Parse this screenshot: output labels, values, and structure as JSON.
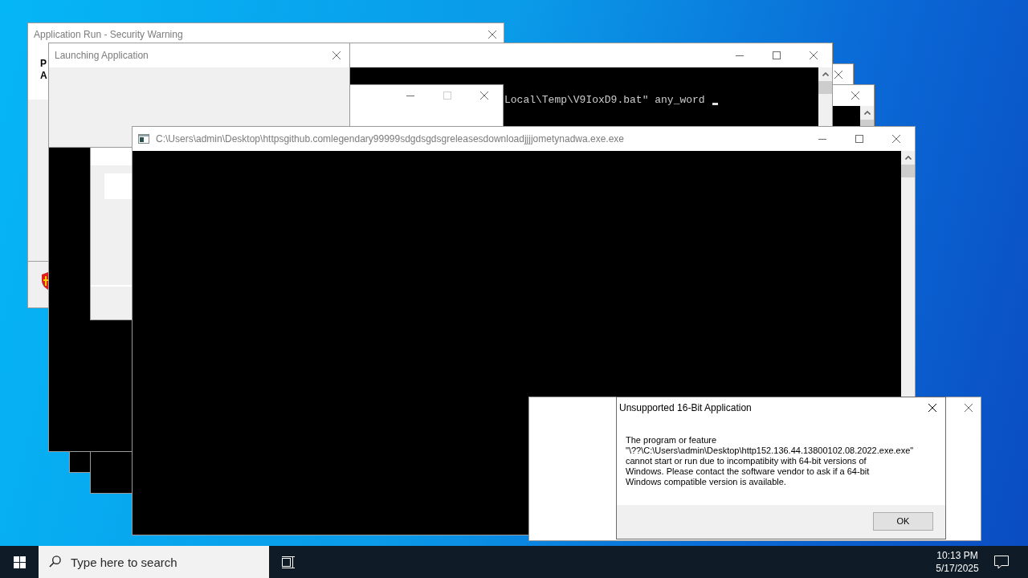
{
  "windows": [
    {
      "kind": "security_warning",
      "title": "Application Run - Security Warning",
      "active": false,
      "heading_lines": [
        "P",
        "A"
      ],
      "controls": [
        {
          "kind": "close",
          "disabled": false
        }
      ]
    },
    {
      "kind": "console",
      "active": false,
      "controls": [
        {
          "kind": "close",
          "disabled": false
        }
      ]
    },
    {
      "kind": "console",
      "active": false,
      "controls": [
        {
          "kind": "close",
          "disabled": false
        }
      ]
    },
    {
      "kind": "console",
      "active": false,
      "output": "Local\\Temp\\V9IoxD9.bat\" any_word",
      "controls": [
        {
          "kind": "minimize",
          "disabled": false
        },
        {
          "kind": "maximize",
          "disabled": false
        },
        {
          "kind": "close",
          "disabled": false
        }
      ]
    },
    {
      "kind": "form",
      "active": false,
      "controls": [
        {
          "kind": "minimize",
          "disabled": false
        },
        {
          "kind": "maximize",
          "disabled": true
        },
        {
          "kind": "close",
          "disabled": false
        }
      ]
    },
    {
      "kind": "launching",
      "title": "Launching Application",
      "active": false,
      "controls": [
        {
          "kind": "close",
          "disabled": false
        }
      ]
    },
    {
      "kind": "console",
      "title": "C:\\Users\\admin\\Desktop\\httpsgithub.comlegendary99999sdgdsgdsgreleasesdownloadjjjjometynadwa.exe.exe",
      "active": false,
      "controls": [
        {
          "kind": "minimize",
          "disabled": false
        },
        {
          "kind": "maximize",
          "disabled": false
        },
        {
          "kind": "close",
          "disabled": false
        }
      ]
    },
    {
      "kind": "dialog",
      "active": false,
      "controls": [
        {
          "kind": "close",
          "disabled": false
        }
      ]
    },
    {
      "kind": "dialog",
      "title": "Unsupported 16-Bit Application",
      "active": true,
      "message_lines": [
        "The program or feature",
        "\"\\??\\C:\\Users\\admin\\Desktop\\http152.136.44.13800102.08.2022.exe.exe\"",
        "cannot start or run due to incompatibity with 64-bit versions of",
        "Windows. Please contact the software vendor to ask if a 64-bit",
        "Windows compatible version is available."
      ],
      "buttons": [
        "OK"
      ],
      "controls": [
        {
          "kind": "close",
          "disabled": false
        }
      ]
    }
  ],
  "taskbar": {
    "search": {
      "placeholder": "Type here to search"
    },
    "clock": {
      "time": "10:13 PM",
      "date": "5/17/2025"
    }
  }
}
